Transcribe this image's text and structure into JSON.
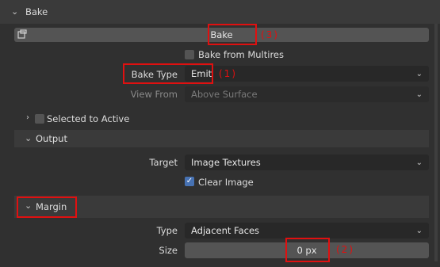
{
  "panel": {
    "title": "Bake"
  },
  "bake_button": {
    "label": "Bake"
  },
  "bake_from_multires": {
    "label": "Bake from Multires",
    "checked": false
  },
  "bake_type": {
    "label": "Bake Type",
    "value": "Emit"
  },
  "view_from": {
    "label": "View From",
    "value": "Above Surface",
    "enabled": false
  },
  "selected_to_active": {
    "label": "Selected to Active",
    "checked": false
  },
  "output": {
    "title": "Output",
    "target": {
      "label": "Target",
      "value": "Image Textures"
    },
    "clear_image": {
      "label": "Clear Image",
      "checked": true
    }
  },
  "margin": {
    "title": "Margin",
    "type": {
      "label": "Type",
      "value": "Adjacent Faces"
    },
    "size": {
      "label": "Size",
      "value": "0 px"
    }
  },
  "annotations": {
    "a1": "(1)",
    "a2": "(2)",
    "a3": "(3)"
  },
  "colors": {
    "annotation": "#e01010",
    "checked_box": "#4772b3"
  },
  "icons": {
    "header_chevron": "chevron-down-icon",
    "bake_icon": "render-bake-icon"
  }
}
